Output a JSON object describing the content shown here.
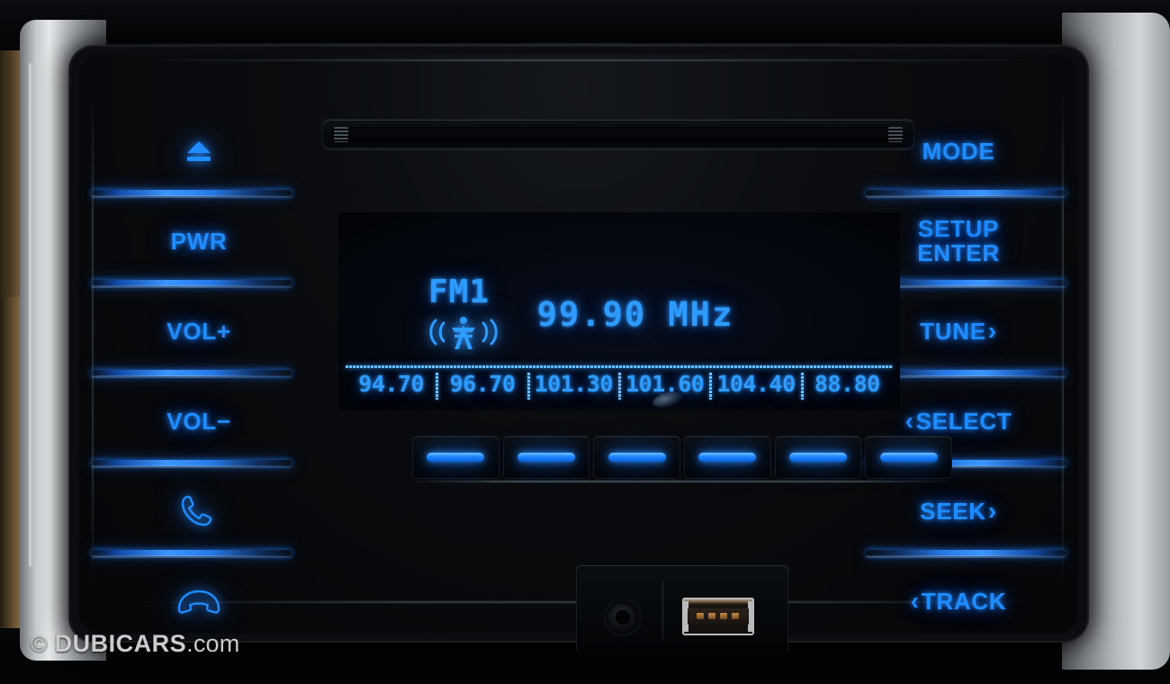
{
  "device": {
    "name": "car-audio-head-unit",
    "accent_color": "#1f8cff",
    "display_color": "#2e9bff"
  },
  "left_keys": [
    {
      "id": "eject",
      "label": "",
      "icon": "eject-icon"
    },
    {
      "id": "power",
      "label": "PWR",
      "icon": ""
    },
    {
      "id": "vol-up",
      "label": "VOL+",
      "icon": ""
    },
    {
      "id": "vol-down",
      "label": "VOL−",
      "icon": ""
    },
    {
      "id": "call",
      "label": "",
      "icon": "phone-call-icon"
    },
    {
      "id": "hangup",
      "label": "",
      "icon": "phone-hangup-icon"
    }
  ],
  "right_keys": [
    {
      "id": "mode",
      "label": "MODE",
      "label2": "",
      "chevron": "",
      "icon": ""
    },
    {
      "id": "setup-enter",
      "label": "SETUP",
      "label2": "ENTER",
      "chevron": "",
      "icon": ""
    },
    {
      "id": "tune",
      "label": "TUNE",
      "label2": "",
      "chevron": "›",
      "chevron_side": "right",
      "icon": "chevron-right-icon"
    },
    {
      "id": "select",
      "label": "SELECT",
      "label2": "",
      "chevron": "‹",
      "chevron_side": "left",
      "icon": "chevron-left-icon"
    },
    {
      "id": "seek",
      "label": "SEEK",
      "label2": "",
      "chevron": "›",
      "chevron_side": "right",
      "icon": "chevron-right-icon"
    },
    {
      "id": "track",
      "label": "TRACK",
      "label2": "",
      "chevron": "‹",
      "chevron_side": "left",
      "icon": "chevron-left-icon"
    }
  ],
  "display": {
    "band": "FM1",
    "tower_icon": "radio-broadcast-icon",
    "frequency": "99.90  MHz",
    "presets": [
      "94.70",
      "96.70",
      "101.30",
      "101.60",
      "104.40",
      "88.80"
    ]
  },
  "preset_buttons": [
    {
      "index": 1,
      "lit": true
    },
    {
      "index": 2,
      "lit": true
    },
    {
      "index": 3,
      "lit": true
    },
    {
      "index": 4,
      "lit": true
    },
    {
      "index": 5,
      "lit": true
    },
    {
      "index": 6,
      "lit": true
    }
  ],
  "ports": {
    "aux": "aux-jack",
    "usb": "usb-port"
  },
  "cd_slot": {
    "label": ""
  },
  "watermark": {
    "copyright": "©",
    "brand": "DUBICARS",
    "tld": ".com"
  }
}
